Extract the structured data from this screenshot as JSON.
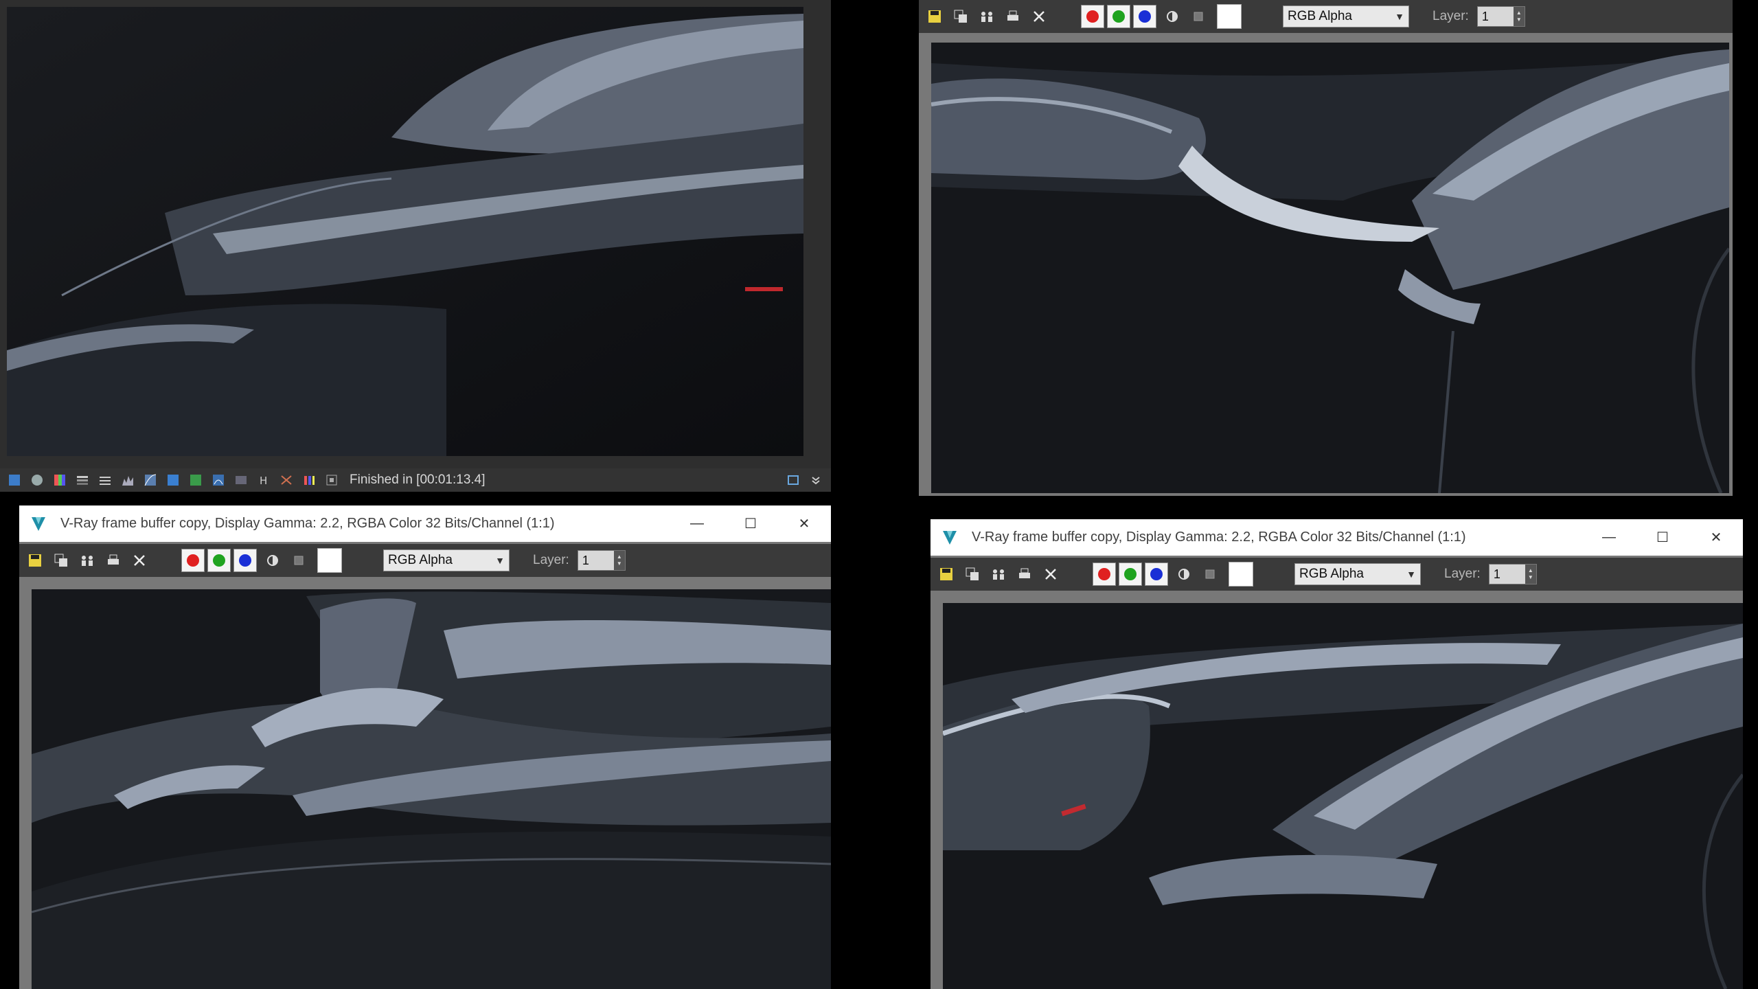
{
  "window_title": "V-Ray frame buffer copy, Display Gamma: 2.2, RGBA Color 32 Bits/Channel (1:1)",
  "window_controls": {
    "minimize": "—",
    "maximize": "☐",
    "close": "✕"
  },
  "toolbar": {
    "channel_select": "RGB Alpha",
    "layer_label": "Layer:",
    "layer_value": "1",
    "channel_colors": {
      "red": "#e02020",
      "green": "#1fa31f",
      "blue": "#1a2fd6"
    }
  },
  "status": {
    "message": "Finished in [00:01:13.4]"
  },
  "icons": {
    "toolbar": [
      "save-icon",
      "copy-icon",
      "clone-icon",
      "print-icon",
      "clear-icon",
      "red-channel-icon",
      "green-channel-icon",
      "blue-channel-icon",
      "mono-icon",
      "alpha-icon",
      "white-swatch"
    ],
    "statusbar": [
      "region-render-icon",
      "info-icon",
      "color-corrections-icon",
      "lut-icon",
      "levels-icon",
      "histogram-icon",
      "curves-icon",
      "background-icon",
      "exposure-icon",
      "white-balance-icon",
      "hue-icon",
      "hsv-icon",
      "lens-effects-icon",
      "stereo-icon",
      "pixel-aspect-icon",
      "restore-icon",
      "expand-icon"
    ]
  },
  "colors": {
    "titlebar": "#ffffff",
    "toolbar": "#3a3a3a",
    "frame": "#787878",
    "render_bg": "#141619"
  }
}
